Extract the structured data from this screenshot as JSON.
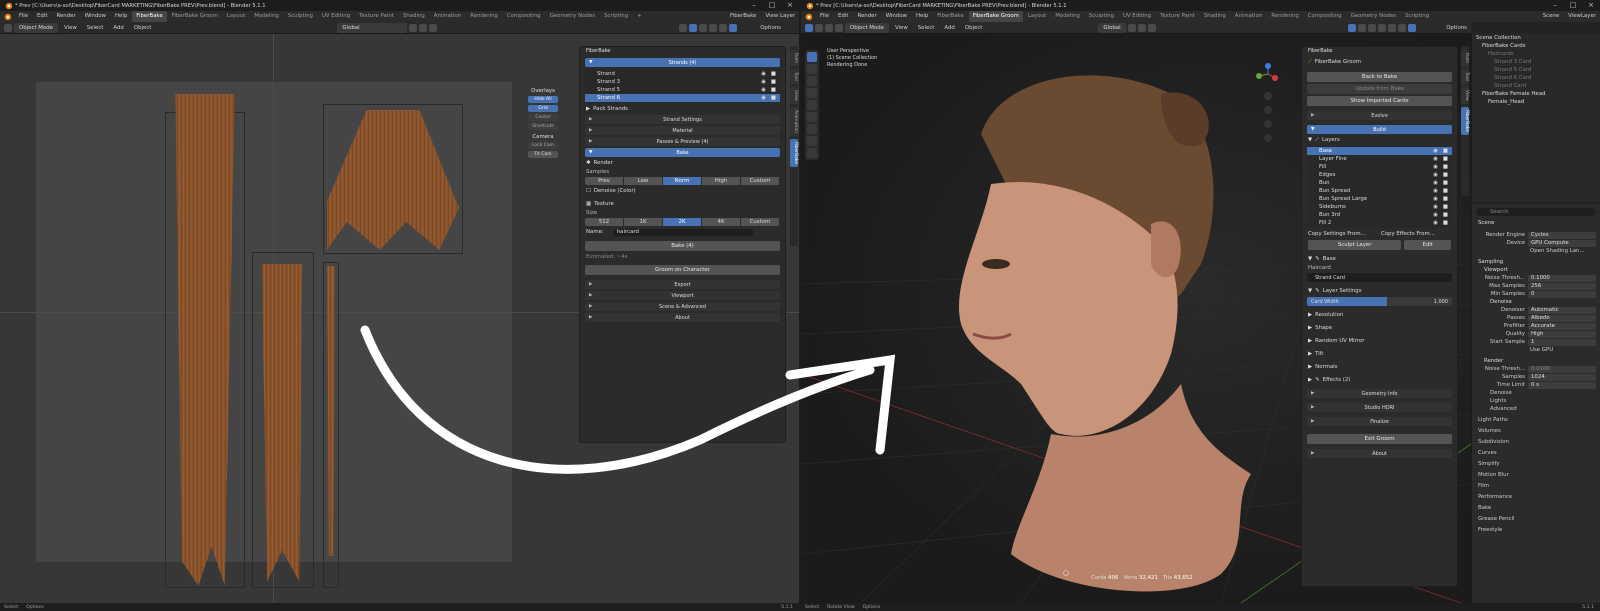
{
  "left": {
    "title": "* Prev [C:\\Users\\a-sol\\Desktop\\FiberCard MARKETING\\FiberBake PREV\\Prev.blend] - Blender 5.1.1",
    "menus": [
      "File",
      "Edit",
      "Render",
      "Window",
      "Help"
    ],
    "workspaces": [
      "FiberBake",
      "FiberBake Groom",
      "Layout",
      "Modeling",
      "Sculpting",
      "UV Editing",
      "Texture Paint",
      "Shading",
      "Animation",
      "Rendering",
      "Compositing",
      "Geometry Nodes",
      "Scripting"
    ],
    "active_workspace": "FiberBake",
    "scene_label": "FiberBake",
    "view_layer": "View Layer",
    "header": {
      "mode": "Object Mode",
      "items": [
        "View",
        "Select",
        "Add",
        "Object"
      ],
      "orientation": "Global",
      "options": "Options"
    },
    "overlays": {
      "title": "Overlays",
      "hide_all": "Hide All",
      "grid": "Grid",
      "center": "Center",
      "shortcuts": "Shortcuts",
      "camera_title": "Camera",
      "lock_cam": "Lock Cam",
      "fit_cam": "Fit Cam"
    },
    "panel": {
      "title": "FiberBake",
      "strands_header": "Strands (4)",
      "strands": [
        "Strand",
        "Strand 3",
        "Strand 5",
        "Strand 6"
      ],
      "pack_strands": "Pack Strands",
      "strand_settings": "Strand Settings",
      "material": "Material",
      "passes_preview": "Passes & Preview (4)",
      "bake": "Bake",
      "render": "Render",
      "samples_label": "Samples",
      "samples": [
        "Prev",
        "Low",
        "Norm",
        "High",
        "Custom"
      ],
      "samples_active": "Norm",
      "denoise": "Denoise (Color)",
      "texture": "Texture",
      "size_label": "Size",
      "sizes": [
        "512",
        "1K",
        "2K",
        "4K",
        "Custom"
      ],
      "size_active": "2K",
      "name_label": "Name:",
      "name_value": "haircard",
      "bake_button": "Bake (4)",
      "estimated": "Estimated: ~4s",
      "groom_button": "Groom on Character",
      "export": "Export",
      "viewport": "Viewport",
      "scene_advanced": "Scene & Advanced",
      "about": "About"
    },
    "side_tabs": [
      "Item",
      "Tool",
      "View",
      "Animation",
      "FiberBake"
    ],
    "status": {
      "select": "Select",
      "options": "Options",
      "version": "5.1.1"
    }
  },
  "right": {
    "title": "* Prev [C:\\Users\\a-sol\\Desktop\\FiberCard MARKETING\\FiberBake PREV\\Prev.blend] - Blender 5.1.1",
    "menus": [
      "File",
      "Edit",
      "Render",
      "Window",
      "Help"
    ],
    "workspaces": [
      "FiberBake",
      "FiberBake Groom",
      "Layout",
      "Modeling",
      "Sculpting",
      "UV Editing",
      "Texture Paint",
      "Shading",
      "Animation",
      "Rendering",
      "Compositing",
      "Geometry Nodes",
      "Scripting"
    ],
    "active_workspace": "FiberBake Groom",
    "scene_label": "Scene",
    "view_layer": "ViewLayer",
    "header": {
      "mode": "Object Mode",
      "items": [
        "View",
        "Select",
        "Add",
        "Object"
      ],
      "orientation": "Global",
      "options": "Options"
    },
    "viewport_info": [
      "User Perspective",
      "(1) Scene Collection",
      "Rendering Done"
    ],
    "stats": {
      "cards_label": "Cards",
      "cards": "406",
      "verts_label": "Verts",
      "verts": "32,421",
      "tris_label": "Tris",
      "tris": "43,652"
    },
    "groom": {
      "title": "FiberBake",
      "subtitle": "FiberBake Groom",
      "back": "Back to Bake",
      "update": "Update from Bake",
      "show_imported": "Show Imported Cards",
      "evolve": "Evolve",
      "build": "Build",
      "layers": "Layers",
      "layer_items": [
        "Base",
        "Layer Fine",
        "Fill",
        "Edges",
        "Bun",
        "Bun Spread",
        "Bun Spread Large",
        "Sideburns",
        "Bun 3rd",
        "Fill 2"
      ],
      "copy_settings": "Copy Settings From...",
      "copy_effects": "Copy Effects From...",
      "sculpt_layer": "Sculpt Layer",
      "edit": "Edit",
      "base": "Base",
      "haircard_label": "Haircard",
      "strand_card": "Strand Card",
      "layer_settings": "Layer Settings",
      "card_width_label": "Card Width",
      "card_width_value": "1.000",
      "card_width_fill": 0.55,
      "resolution": "Resolution",
      "shape": "Shape",
      "random_uv": "Random UV Mirror",
      "tilt": "Tilt",
      "normals": "Normals",
      "effects": "Effects (2)",
      "geometry_info": "Geometry Info",
      "studio_hdri": "Studio HDRI",
      "finalize": "Finalize",
      "exit_groom": "Exit Groom",
      "about": "About"
    },
    "outliner": {
      "root": "Scene Collection",
      "items": [
        {
          "name": "FiberBake Cards",
          "indent": 1,
          "dim": false
        },
        {
          "name": "Haircards",
          "indent": 2,
          "dim": true
        },
        {
          "name": "Strand 3 Card",
          "indent": 3,
          "dim": true
        },
        {
          "name": "Strand 5 Card",
          "indent": 3,
          "dim": true
        },
        {
          "name": "Strand 6 Card",
          "indent": 3,
          "dim": true
        },
        {
          "name": "Strand Card",
          "indent": 3,
          "dim": true
        },
        {
          "name": "FiberBake Female Head",
          "indent": 1,
          "dim": false
        },
        {
          "name": "Female_Head",
          "indent": 2,
          "dim": false
        }
      ]
    },
    "properties": {
      "search": "Search",
      "scene": "Scene",
      "render_engine_label": "Render Engine",
      "render_engine": "Cycles",
      "device_label": "Device",
      "device": "GPU Compute",
      "open_shading": "Open Shading Lan...",
      "sampling": "Sampling",
      "viewport": "Viewport",
      "noise_threshold_label": "Noise Thresh...",
      "noise_threshold": "0.1000",
      "max_samples_label": "Max Samples",
      "max_samples": "256",
      "min_samples_label": "Min Samples",
      "min_samples": "0",
      "denoise": "Denoise",
      "denoiser_label": "Denoiser",
      "denoiser": "Automatic",
      "passes_label": "Passes",
      "passes": "Albedo",
      "prefilter_label": "Prefilter",
      "prefilter": "Accurate",
      "quality_label": "Quality",
      "quality": "High",
      "start_sample_label": "Start Sample",
      "start_sample": "1",
      "use_gpu": "Use GPU",
      "render": "Render",
      "r_noise_label": "Noise Thresh...",
      "r_noise": "0.0100",
      "samples_label": "Samples",
      "samples": "1024",
      "time_limit_label": "Time Limit",
      "time_limit": "0 s",
      "sub_denoise": "Denoise",
      "lights": "Lights",
      "advanced": "Advanced",
      "sections": [
        "Light Paths",
        "Volumes",
        "Subdivision",
        "Curves",
        "Simplify",
        "Motion Blur",
        "Film",
        "Performance",
        "Bake",
        "Grease Pencil",
        "Freestyle"
      ]
    },
    "status": {
      "select": "Select",
      "rotate": "Rotate View",
      "options": "Options",
      "version": "5.1.1"
    }
  }
}
